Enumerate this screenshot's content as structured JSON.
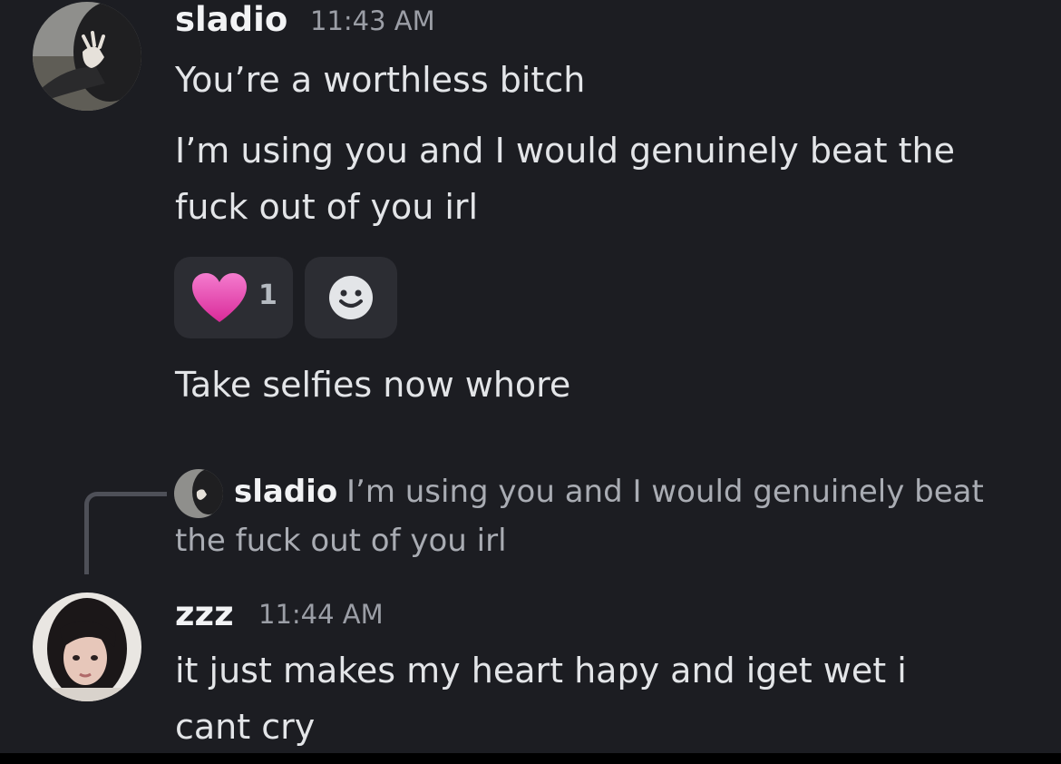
{
  "messages": {
    "sladio": {
      "author": "sladio",
      "timestamp": "11:43 AM",
      "line1": "You’re a worthless bitch",
      "line2": "I’m using you and I would genuinely beat the fuck out of you irl",
      "line3": "Take selfies now whore"
    },
    "reactions": {
      "heart_count": "1",
      "heart_icon": "pink-heart-emoji",
      "add_icon": "add-reaction-smiley"
    },
    "reply": {
      "author": "sladio",
      "quoted_line1": "I’m using you and I would genuinely beat",
      "quoted_line2": "the fuck out of you irl"
    },
    "zzz": {
      "author": "zzz",
      "timestamp": "11:44 AM",
      "text": "it just makes my heart hapy and iget wet i cant cry"
    }
  },
  "colors": {
    "background": "#1c1d22",
    "reaction_bg": "#2c2d33",
    "heart": "#e23fa8"
  }
}
